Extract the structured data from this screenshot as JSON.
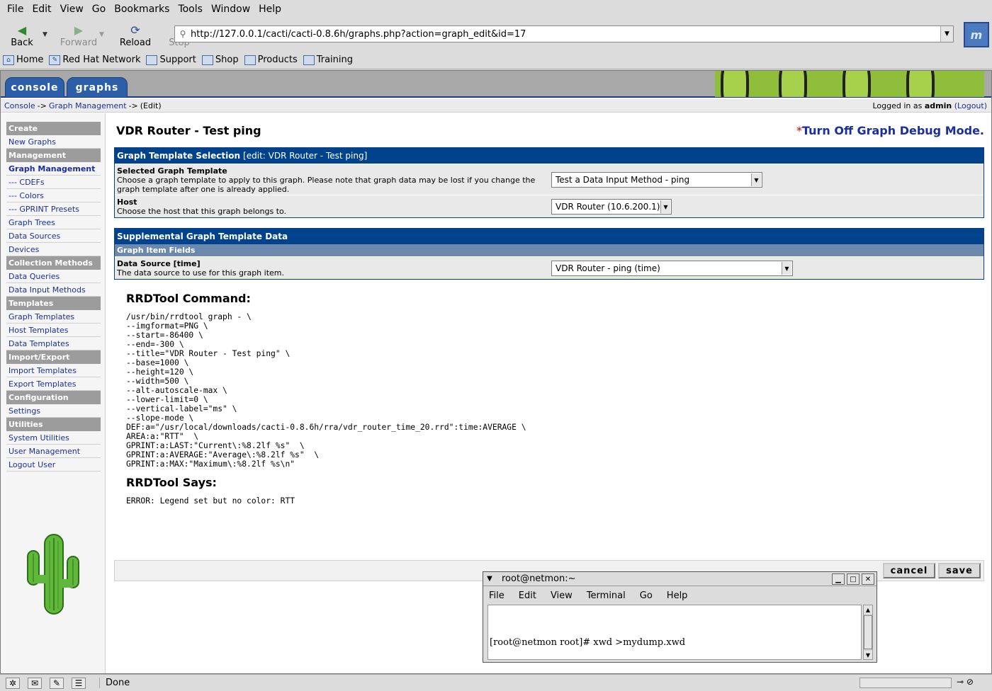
{
  "browser": {
    "menu": [
      "File",
      "Edit",
      "View",
      "Go",
      "Bookmarks",
      "Tools",
      "Window",
      "Help"
    ],
    "nav": {
      "back": "Back",
      "forward": "Forward",
      "reload": "Reload",
      "stop": "Stop"
    },
    "url": "http://127.0.0.1/cacti/cacti-0.8.6h/graphs.php?action=graph_edit&id=17",
    "bookmarks": [
      "Home",
      "Red Hat Network",
      "Support",
      "Shop",
      "Products",
      "Training"
    ],
    "status": "Done"
  },
  "cacti": {
    "tabs": [
      "console",
      "graphs"
    ],
    "breadcrumb": {
      "console": "Console",
      "sep1": "->",
      "graph_management": "Graph Management",
      "sep2": "->",
      "edit": "(Edit)"
    },
    "login": {
      "prefix": "Logged in as",
      "user": "admin",
      "logout": "(Logout)"
    },
    "sidebar": [
      {
        "type": "head",
        "label": "Create"
      },
      {
        "type": "item",
        "label": "New Graphs"
      },
      {
        "type": "head",
        "label": "Management"
      },
      {
        "type": "item",
        "label": "Graph Management",
        "active": true
      },
      {
        "type": "item",
        "label": "--- CDEFs"
      },
      {
        "type": "item",
        "label": "--- Colors"
      },
      {
        "type": "item",
        "label": "--- GPRINT Presets"
      },
      {
        "type": "item",
        "label": "Graph Trees"
      },
      {
        "type": "item",
        "label": "Data Sources"
      },
      {
        "type": "item",
        "label": "Devices"
      },
      {
        "type": "head",
        "label": "Collection Methods"
      },
      {
        "type": "item",
        "label": "Data Queries"
      },
      {
        "type": "item",
        "label": "Data Input Methods"
      },
      {
        "type": "head",
        "label": "Templates"
      },
      {
        "type": "item",
        "label": "Graph Templates"
      },
      {
        "type": "item",
        "label": "Host Templates"
      },
      {
        "type": "item",
        "label": "Data Templates"
      },
      {
        "type": "head",
        "label": "Import/Export"
      },
      {
        "type": "item",
        "label": "Import Templates"
      },
      {
        "type": "item",
        "label": "Export Templates"
      },
      {
        "type": "head",
        "label": "Configuration"
      },
      {
        "type": "item",
        "label": "Settings"
      },
      {
        "type": "head",
        "label": "Utilities"
      },
      {
        "type": "item",
        "label": "System Utilities"
      },
      {
        "type": "item",
        "label": "User Management"
      },
      {
        "type": "item",
        "label": "Logout User"
      }
    ],
    "page_title": "VDR Router - Test ping",
    "debug_star": "*",
    "debug_link": "Turn Off Graph Debug Mode.",
    "template_box": {
      "title": "Graph Template Selection",
      "title_suffix": "[edit: VDR Router - Test ping]",
      "template_label": "Selected Graph Template",
      "template_desc": "Choose a graph template to apply to this graph. Please note that graph data may be lost if you change the graph template after one is already applied.",
      "template_value": "Test a Data Input Method - ping",
      "host_label": "Host",
      "host_desc": "Choose the host that this graph belongs to.",
      "host_value": "VDR Router (10.6.200.1)"
    },
    "supp_box": {
      "title": "Supplemental Graph Template Data",
      "subtitle": "Graph Item Fields",
      "ds_label": "Data Source [time]",
      "ds_desc": "The data source to use for this graph item.",
      "ds_value": "VDR Router - ping (time)"
    },
    "rrd_command_heading": "RRDTool Command:",
    "rrd_command": "/usr/bin/rrdtool graph - \\\n--imgformat=PNG \\\n--start=-86400 \\\n--end=-300 \\\n--title=\"VDR Router - Test ping\" \\\n--base=1000 \\\n--height=120 \\\n--width=500 \\\n--alt-autoscale-max \\\n--lower-limit=0 \\\n--vertical-label=\"ms\" \\\n--slope-mode \\\nDEF:a=\"/usr/local/downloads/cacti-0.8.6h/rra/vdr_router_time_20.rrd\":time:AVERAGE \\\nAREA:a:\"RTT\"  \\\nGPRINT:a:LAST:\"Current\\:%8.2lf %s\"  \\\nGPRINT:a:AVERAGE:\"Average\\:%8.2lf %s\"  \\\nGPRINT:a:MAX:\"Maximum\\:%8.2lf %s\\n\"",
    "rrd_says_heading": "RRDTool Says:",
    "rrd_says": "ERROR: Legend set but no color: RTT",
    "buttons": {
      "cancel": "cancel",
      "save": "save"
    }
  },
  "terminal": {
    "title": "root@netmon:~",
    "menu": [
      "File",
      "Edit",
      "View",
      "Terminal",
      "Go",
      "Help"
    ],
    "line": "[root@netmon root]# xwd >mydump.xwd"
  }
}
